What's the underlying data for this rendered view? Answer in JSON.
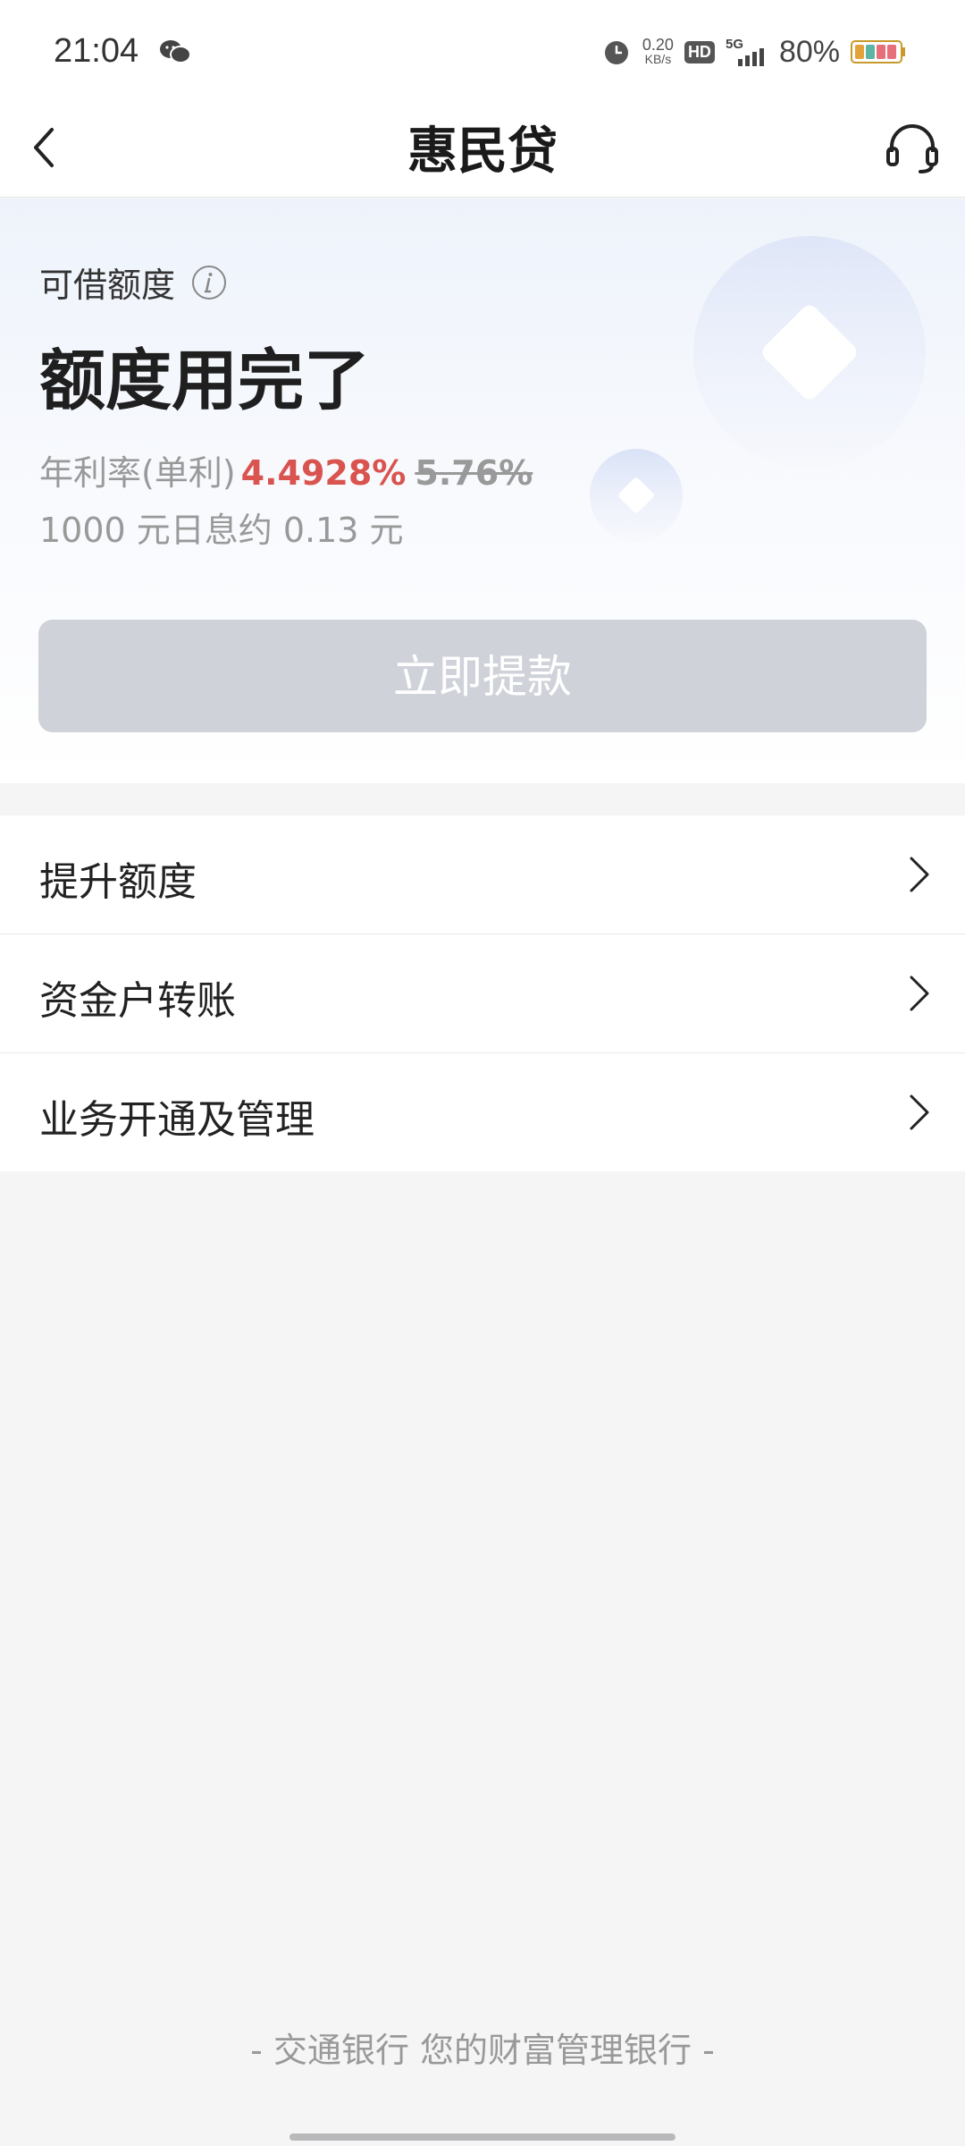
{
  "status_bar": {
    "time": "21:04",
    "net_speed_value": "0.20",
    "net_speed_unit": "KB/s",
    "hd_badge": "HD",
    "signal": "5G",
    "battery_percent": "80%"
  },
  "nav": {
    "title": "惠民贷"
  },
  "hero": {
    "available_label": "可借额度",
    "quota_status": "额度用完了",
    "rate_label": "年利率(单利)",
    "rate_current": "4.4928%",
    "rate_original": "5.76%",
    "daily_interest": "1000 元日息约 0.13 元",
    "withdraw_button": "立即提款"
  },
  "menu": {
    "items": [
      {
        "label": "提升额度"
      },
      {
        "label": "资金户转账"
      },
      {
        "label": "业务开通及管理"
      }
    ]
  },
  "footer": {
    "slogan": "- 交通银行 您的财富管理银行 -"
  },
  "colors": {
    "rate_highlight": "#d9534f",
    "disabled_button": "#cfd2d9",
    "page_background": "#f5f5f6"
  }
}
